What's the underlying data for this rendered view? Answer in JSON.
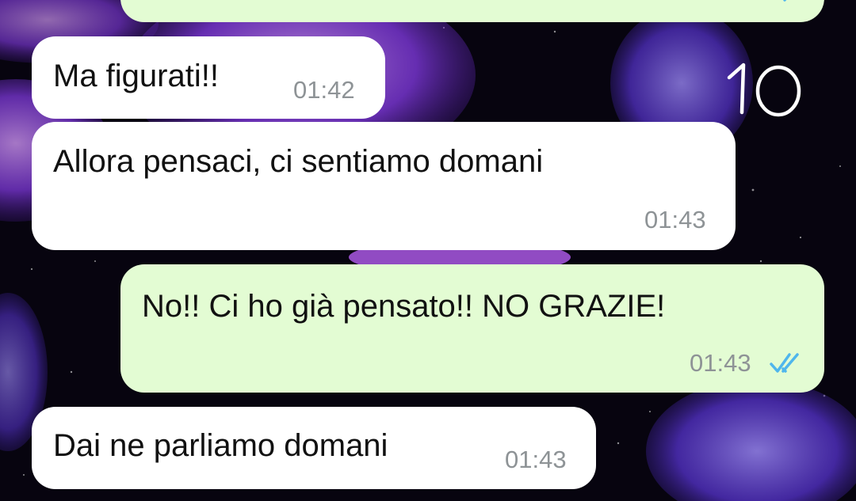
{
  "conversation": {
    "messages": [
      {
        "direction": "incoming",
        "text": "Ma figurati!!",
        "time": "01:42"
      },
      {
        "direction": "incoming",
        "text": "Allora pensaci, ci sentiamo domani",
        "time": "01:43"
      },
      {
        "direction": "outgoing",
        "text": "No!! Ci ho già pensato!! NO GRAZIE!",
        "time": "01:43",
        "status": "read",
        "status_icon": "double-check-icon"
      },
      {
        "direction": "incoming",
        "text": "Dai ne parliamo domani",
        "time": "01:43"
      }
    ]
  },
  "annotation": {
    "handwritten_text": "10"
  },
  "colors": {
    "incoming_bubble": "#ffffff",
    "outgoing_bubble": "#e3fcd3",
    "timestamp": "#8e9396",
    "read_ticks": "#4fb6ec",
    "wallpaper_base": "#07040f",
    "jellyfish": "#8a3df0"
  },
  "wallpaper": {
    "theme": "purple jellyfish on starry night"
  }
}
